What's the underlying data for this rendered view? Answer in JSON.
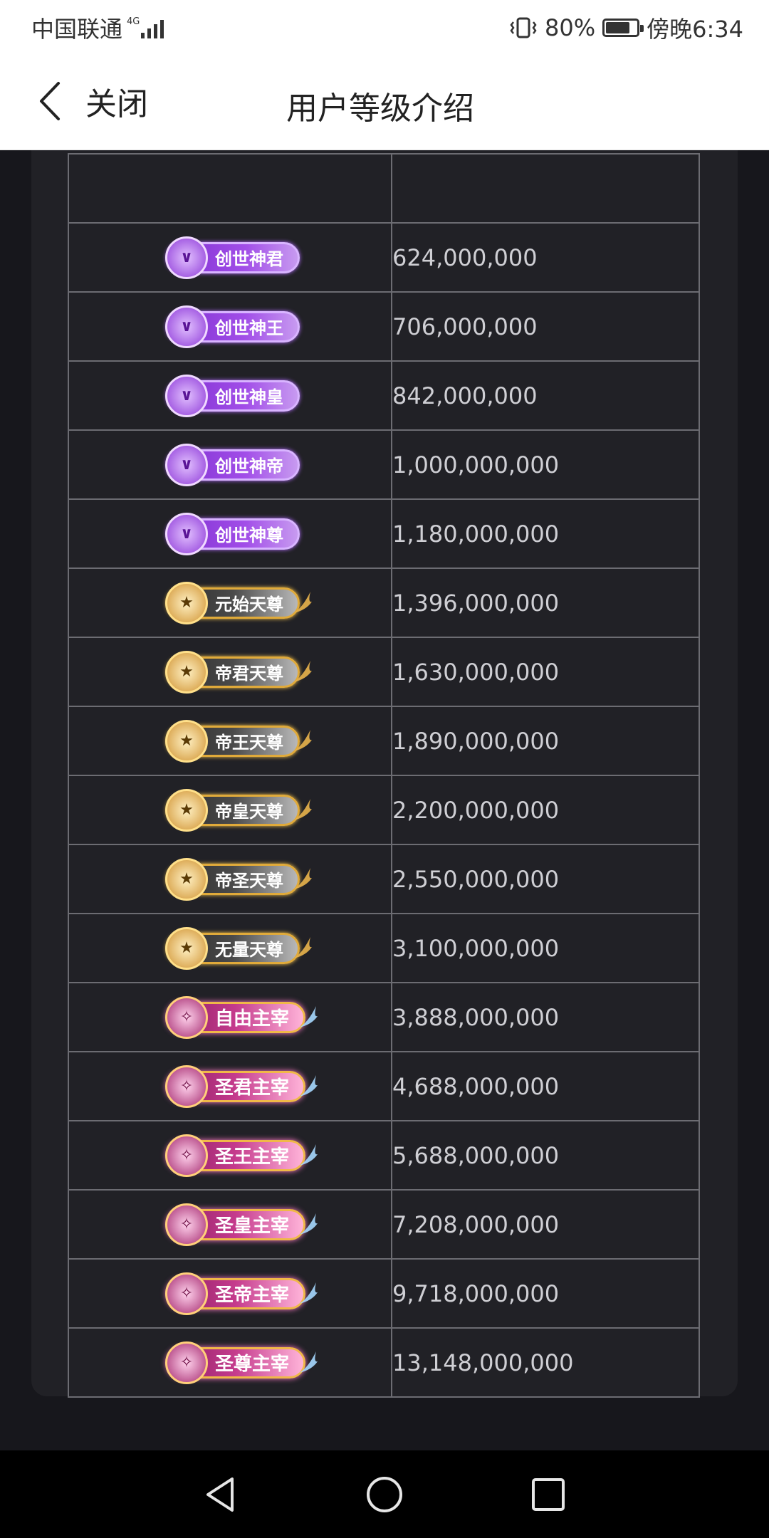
{
  "status": {
    "carrier": "中国联通",
    "network": "4G",
    "battery": "80%",
    "battery_level": 0.8,
    "time": "傍晚6:34"
  },
  "nav": {
    "close_label": "关闭",
    "title": "用户等级介绍"
  },
  "levels": [
    {
      "name": "创世神君",
      "value": "624,000,000",
      "tier": "t1"
    },
    {
      "name": "创世神王",
      "value": "706,000,000",
      "tier": "t1"
    },
    {
      "name": "创世神皇",
      "value": "842,000,000",
      "tier": "t1"
    },
    {
      "name": "创世神帝",
      "value": "1,000,000,000",
      "tier": "t1"
    },
    {
      "name": "创世神尊",
      "value": "1,180,000,000",
      "tier": "t1"
    },
    {
      "name": "元始天尊",
      "value": "1,396,000,000",
      "tier": "t2"
    },
    {
      "name": "帝君天尊",
      "value": "1,630,000,000",
      "tier": "t2"
    },
    {
      "name": "帝王天尊",
      "value": "1,890,000,000",
      "tier": "t2"
    },
    {
      "name": "帝皇天尊",
      "value": "2,200,000,000",
      "tier": "t2"
    },
    {
      "name": "帝圣天尊",
      "value": "2,550,000,000",
      "tier": "t2"
    },
    {
      "name": "无量天尊",
      "value": "3,100,000,000",
      "tier": "t2"
    },
    {
      "name": "自由主宰",
      "value": "3,888,000,000",
      "tier": "t3"
    },
    {
      "name": "圣君主宰",
      "value": "4,688,000,000",
      "tier": "t3"
    },
    {
      "name": "圣王主宰",
      "value": "5,688,000,000",
      "tier": "t3"
    },
    {
      "name": "圣皇主宰",
      "value": "7,208,000,000",
      "tier": "t3"
    },
    {
      "name": "圣帝主宰",
      "value": "9,718,000,000",
      "tier": "t3"
    },
    {
      "name": "圣尊主宰",
      "value": "13,148,000,000",
      "tier": "t3"
    }
  ],
  "icons": {
    "t1_emblem": "shield-chevron-icon",
    "t2_emblem": "gold-shield-icon",
    "t3_emblem": "pink-shield-icon"
  },
  "colors": {
    "background": "#17171c",
    "card": "#212126",
    "table_border": "#6c6c72",
    "value_text": "#cfcfd4"
  }
}
